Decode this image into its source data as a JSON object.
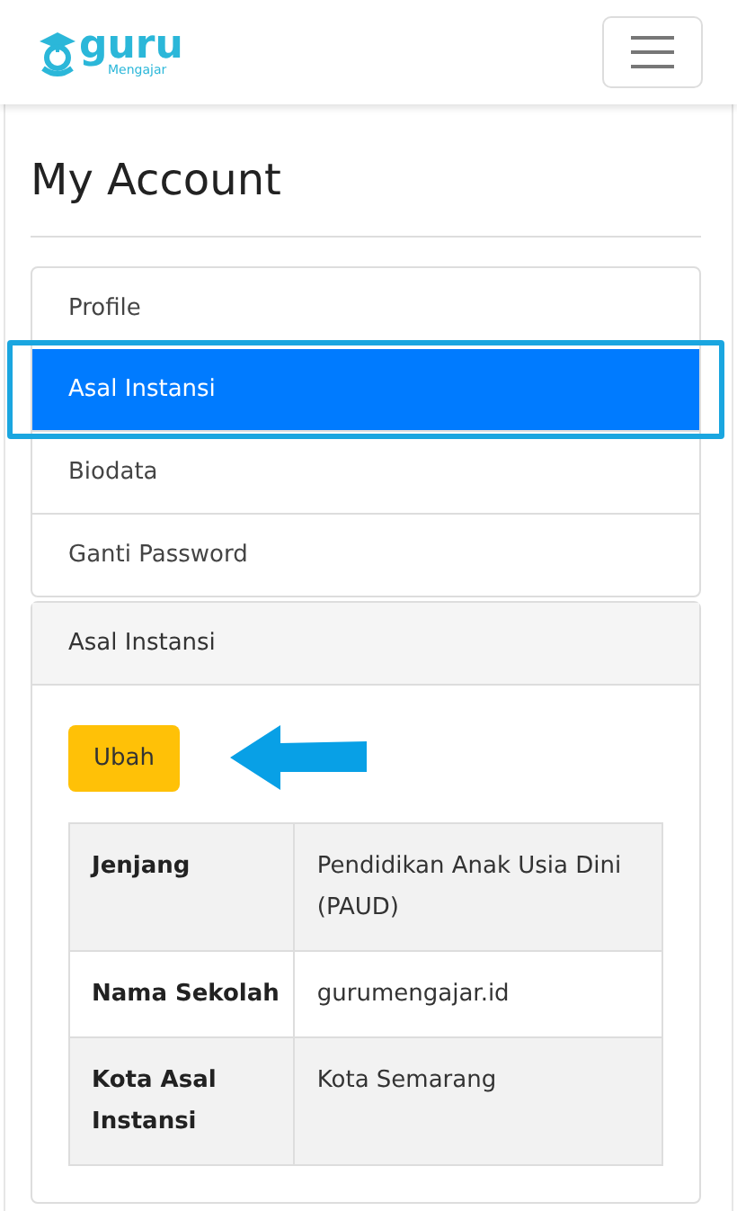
{
  "brand": {
    "name": "guru",
    "tagline": "Mengajar"
  },
  "page_title": "My Account",
  "menu": [
    {
      "label": "Profile",
      "selected": false
    },
    {
      "label": "Asal Instansi",
      "selected": true
    },
    {
      "label": "Biodata",
      "selected": false
    },
    {
      "label": "Ganti Password",
      "selected": false
    }
  ],
  "panel": {
    "title": "Asal Instansi",
    "button": "Ubah",
    "rows": [
      {
        "label": "Jenjang",
        "value": "Pendidikan Anak Usia Dini (PAUD)"
      },
      {
        "label": "Nama Sekolah",
        "value": "gurumengajar.id"
      },
      {
        "label": "Kota Asal Instansi",
        "value": "Kota Semarang"
      }
    ]
  }
}
